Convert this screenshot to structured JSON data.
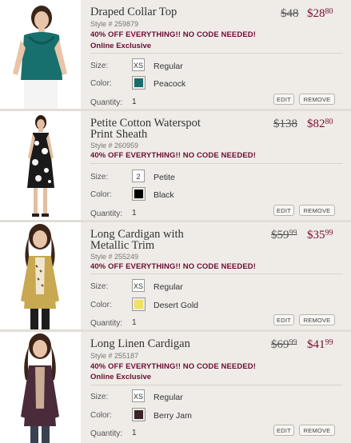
{
  "labels": {
    "size": "Size:",
    "color": "Color:",
    "quantity": "Quantity:",
    "edit": "EDIT",
    "remove": "REMOVE"
  },
  "items": [
    {
      "name": "Draped Collar Top",
      "style": "Style # 259879",
      "promo": "40% OFF EVERYTHING!! NO CODE NEEDED!",
      "exclusive": "Online Exclusive",
      "price_old": "$48",
      "price_new_main": "$28",
      "price_new_cents": "80",
      "size_code": "XS",
      "size_name": "Regular",
      "color_name": "Peacock",
      "color_hex": "#1a6b6e",
      "quantity": "1"
    },
    {
      "name": "Petite Cotton Waterspot Print Sheath",
      "style": "Style # 260959",
      "promo": "40% OFF EVERYTHING!! NO CODE NEEDED!",
      "price_old": "$138",
      "price_new_main": "$82",
      "price_new_cents": "80",
      "size_code": "2",
      "size_name": "Petite",
      "color_name": "Black",
      "color_hex": "#000000",
      "quantity": "1"
    },
    {
      "name": "Long Cardigan with Metallic Trim",
      "style": "Style # 255249",
      "promo": "40% OFF EVERYTHING!! NO CODE NEEDED!",
      "price_old_main": "$59",
      "price_old_cents": "99",
      "price_new_main": "$35",
      "price_new_cents": "99",
      "size_code": "XS",
      "size_name": "Regular",
      "color_name": "Desert Gold",
      "color_hex": "#f1e160",
      "quantity": "1"
    },
    {
      "name": "Long Linen Cardigan",
      "style": "Style # 255187",
      "promo": "40% OFF EVERYTHING!! NO CODE NEEDED!",
      "exclusive": "Online Exclusive",
      "price_old_main": "$69",
      "price_old_cents": "99",
      "price_new_main": "$41",
      "price_new_cents": "99",
      "size_code": "XS",
      "size_name": "Regular",
      "color_name": "Berry Jam",
      "color_hex": "#3b2328",
      "quantity": "1"
    }
  ]
}
